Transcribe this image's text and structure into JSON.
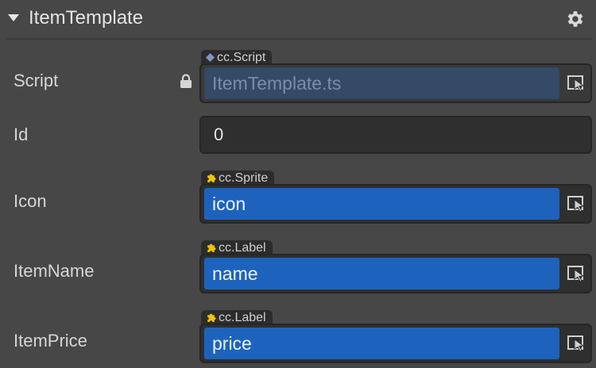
{
  "component": {
    "title": "ItemTemplate",
    "settings_icon": "gear-icon"
  },
  "fields": {
    "script": {
      "label": "Script",
      "type_tag": "cc.Script",
      "value": "ItemTemplate.ts"
    },
    "id": {
      "label": "Id",
      "value": "0"
    },
    "icon": {
      "label": "Icon",
      "type_tag": "cc.Sprite",
      "value": "icon"
    },
    "item_name": {
      "label": "ItemName",
      "type_tag": "cc.Label",
      "value": "name"
    },
    "item_price": {
      "label": "ItemPrice",
      "type_tag": "cc.Label",
      "value": "price"
    }
  },
  "colors": {
    "background": "#474747",
    "reference_fill": "#1d63bd",
    "script_fill": "#344a66",
    "component_badge": "#f5c400",
    "script_badge": "#7d98bf"
  }
}
